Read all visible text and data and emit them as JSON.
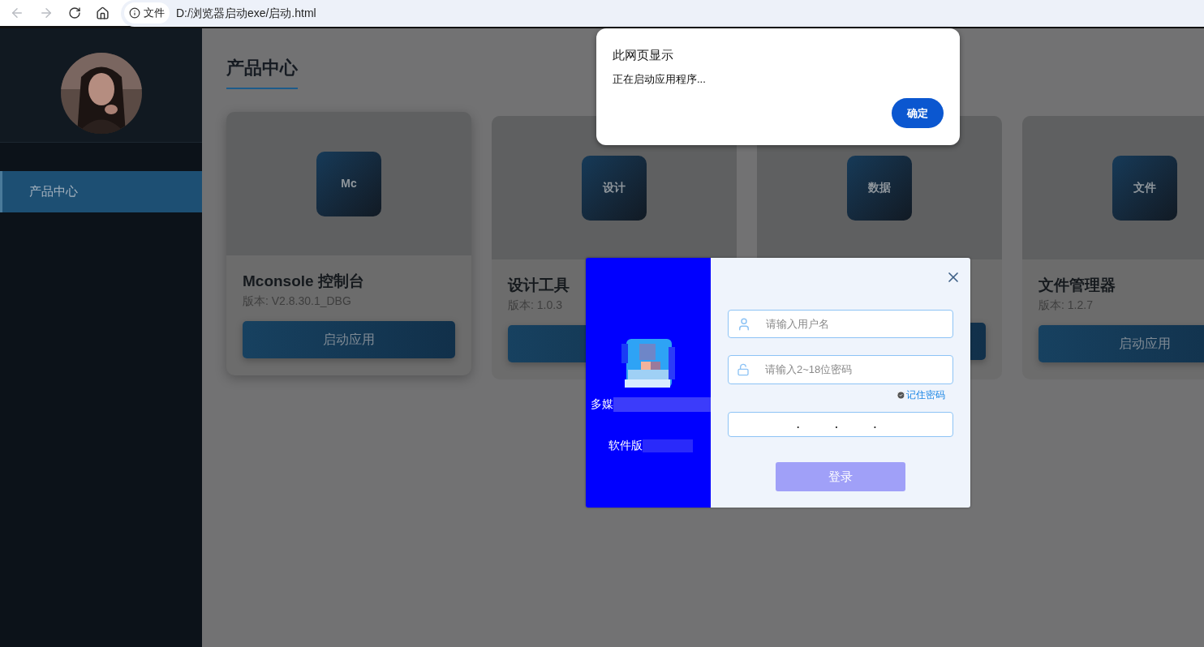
{
  "browser": {
    "back_disabled": true,
    "forward_disabled": true,
    "security_label": "文件",
    "url": "D:/浏览器启动exe/启动.html"
  },
  "sidebar": {
    "items": [
      {
        "label": "产品中心",
        "selected": true
      }
    ]
  },
  "page_title": "产品中心",
  "cards": [
    {
      "icon_text": "Mc",
      "title": "Mconsole 控制台",
      "version": "版本: V2.8.30.1_DBG",
      "button": "启动应用",
      "raised": true
    },
    {
      "icon_text": "设计",
      "title": "设计工具",
      "version": "版本: 1.0.3",
      "raised": false
    },
    {
      "icon_text": "数据",
      "raised": false
    },
    {
      "icon_text": "文件",
      "title": "文件管理器",
      "version": "版本: 1.2.7",
      "button": "启动应用",
      "raised": false
    }
  ],
  "alert": {
    "title": "此网页显示",
    "message": "正在启动应用程序...",
    "ok_button": "确定"
  },
  "login": {
    "brand_line_1": "多媒",
    "brand_line_2": "软件版",
    "username": {
      "placeholder": "请输入用户名"
    },
    "password": {
      "placeholder": "请输入2~18位密码"
    },
    "remember": {
      "label": "记住密码",
      "checked": true
    },
    "address_field": {
      "separators": [
        ".",
        ".",
        "."
      ]
    },
    "login_button": {
      "label": "登录",
      "disabled": true
    }
  }
}
